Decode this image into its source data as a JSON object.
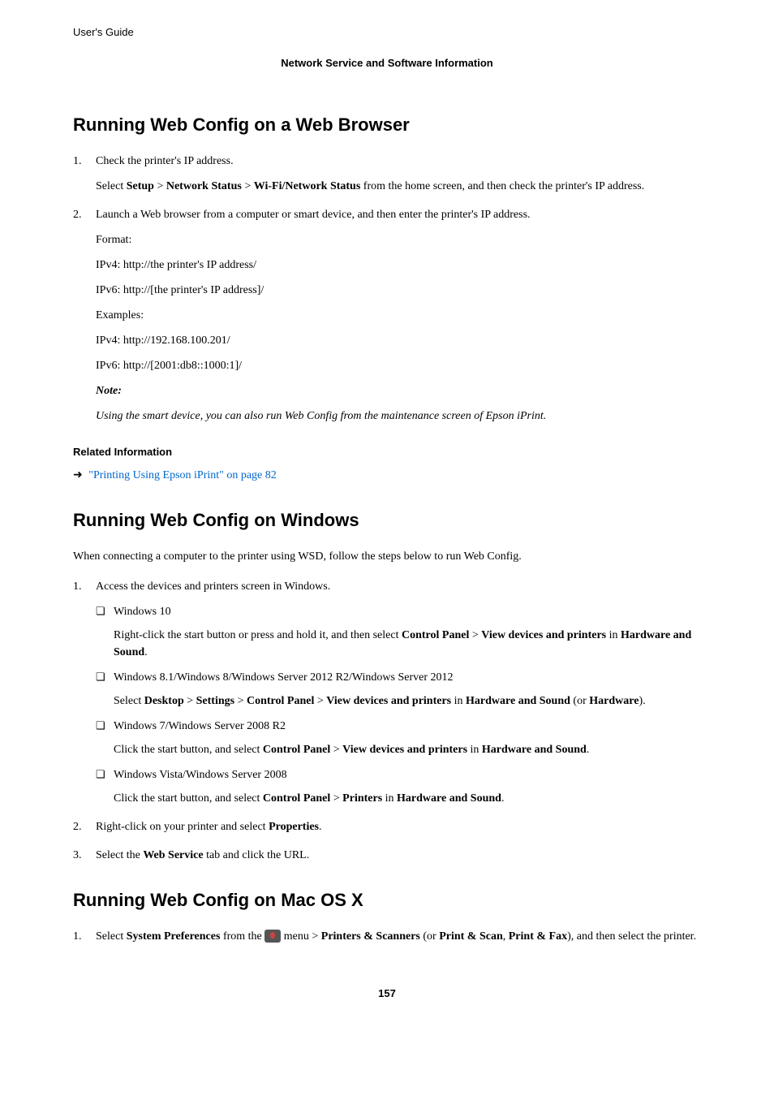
{
  "header": {
    "left": "User's Guide",
    "center": "Network Service and Software Information"
  },
  "section1": {
    "title": "Running Web Config on a Web Browser",
    "step1": {
      "main": "Check the printer's IP address.",
      "detail_pre": "Select ",
      "b1": "Setup",
      "gt1": " > ",
      "b2": "Network Status",
      "gt2": " > ",
      "b3": "Wi-Fi/Network Status",
      "detail_post": " from the home screen, and then check the printer's IP address."
    },
    "step2": {
      "main": "Launch a Web browser from a computer or smart device, and then enter the printer's IP address.",
      "format_label": "Format:",
      "ipv4_fmt": "IPv4: http://the printer's IP address/",
      "ipv6_fmt": "IPv6: http://[the printer's IP address]/",
      "examples_label": "Examples:",
      "ipv4_ex": "IPv4: http://192.168.100.201/",
      "ipv6_ex": "IPv6: http://[2001:db8::1000:1]/",
      "note_label": "Note:",
      "note_text": "Using the smart device, you can also run Web Config from the maintenance screen of Epson iPrint."
    },
    "related_heading": "Related Information",
    "related_link": "\"Printing Using Epson iPrint\" on page 82"
  },
  "section2": {
    "title": "Running Web Config on Windows",
    "intro": "When connecting a computer to the printer using WSD, follow the steps below to run Web Config.",
    "step1": {
      "main": "Access the devices and printers screen in Windows.",
      "win10": {
        "label": "Windows 10",
        "pre": "Right-click the start button or press and hold it, and then select ",
        "b1": "Control Panel",
        "gt1": " > ",
        "b2": "View devices and printers",
        "mid": " in ",
        "b3": "Hardware and Sound",
        "post": "."
      },
      "win8": {
        "label": "Windows 8.1/Windows 8/Windows Server 2012 R2/Windows Server 2012",
        "pre": "Select ",
        "b1": "Desktop",
        "gt1": " > ",
        "b2": "Settings",
        "gt2": " > ",
        "b3": "Control Panel",
        "gt3": " > ",
        "b4": "View devices and printers",
        "mid": " in ",
        "b5": "Hardware and Sound",
        "mid2": " (or ",
        "b6": "Hardware",
        "post": ")."
      },
      "win7": {
        "label": "Windows 7/Windows Server 2008 R2",
        "pre": "Click the start button, and select ",
        "b1": "Control Panel",
        "gt1": " > ",
        "b2": "View devices and printers",
        "mid": " in ",
        "b3": "Hardware and Sound",
        "post": "."
      },
      "vista": {
        "label": "Windows Vista/Windows Server 2008",
        "pre": "Click the start button, and select ",
        "b1": "Control Panel",
        "gt1": " > ",
        "b2": "Printers",
        "mid": " in ",
        "b3": "Hardware and Sound",
        "post": "."
      }
    },
    "step2": {
      "pre": "Right-click on your printer and select ",
      "b1": "Properties",
      "post": "."
    },
    "step3": {
      "pre": "Select the ",
      "b1": "Web Service",
      "post": " tab and click the URL."
    }
  },
  "section3": {
    "title": "Running Web Config on Mac OS X",
    "step1": {
      "pre": "Select ",
      "b1": "System Preferences",
      "mid1": " from the ",
      "mid2": " menu > ",
      "b2": "Printers & Scanners",
      "mid3": " (or ",
      "b3": "Print & Scan",
      "mid4": ", ",
      "b4": "Print & Fax",
      "post": "), and then select the printer."
    }
  },
  "page_number": "157"
}
